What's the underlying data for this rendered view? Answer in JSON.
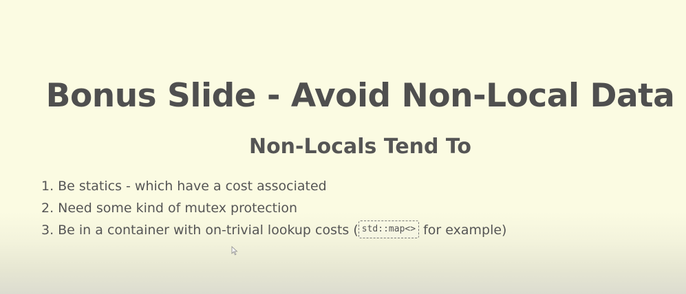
{
  "slide": {
    "title": "Bonus Slide - Avoid Non-Local Data",
    "subtitle": "Non-Locals Tend To",
    "items": [
      {
        "num": "1.",
        "text": "Be statics - which have a cost associated"
      },
      {
        "num": "2.",
        "text": "Need some kind of mutex protection"
      },
      {
        "num": "3.",
        "text_before": "Be in a container with on-trivial lookup costs (",
        "code": "std::map<>",
        "text_after": " for example)"
      }
    ]
  },
  "colors": {
    "background": "#fbfbe2",
    "text": "#505050"
  },
  "icons": {
    "cursor": "mouse-pointer-icon"
  }
}
